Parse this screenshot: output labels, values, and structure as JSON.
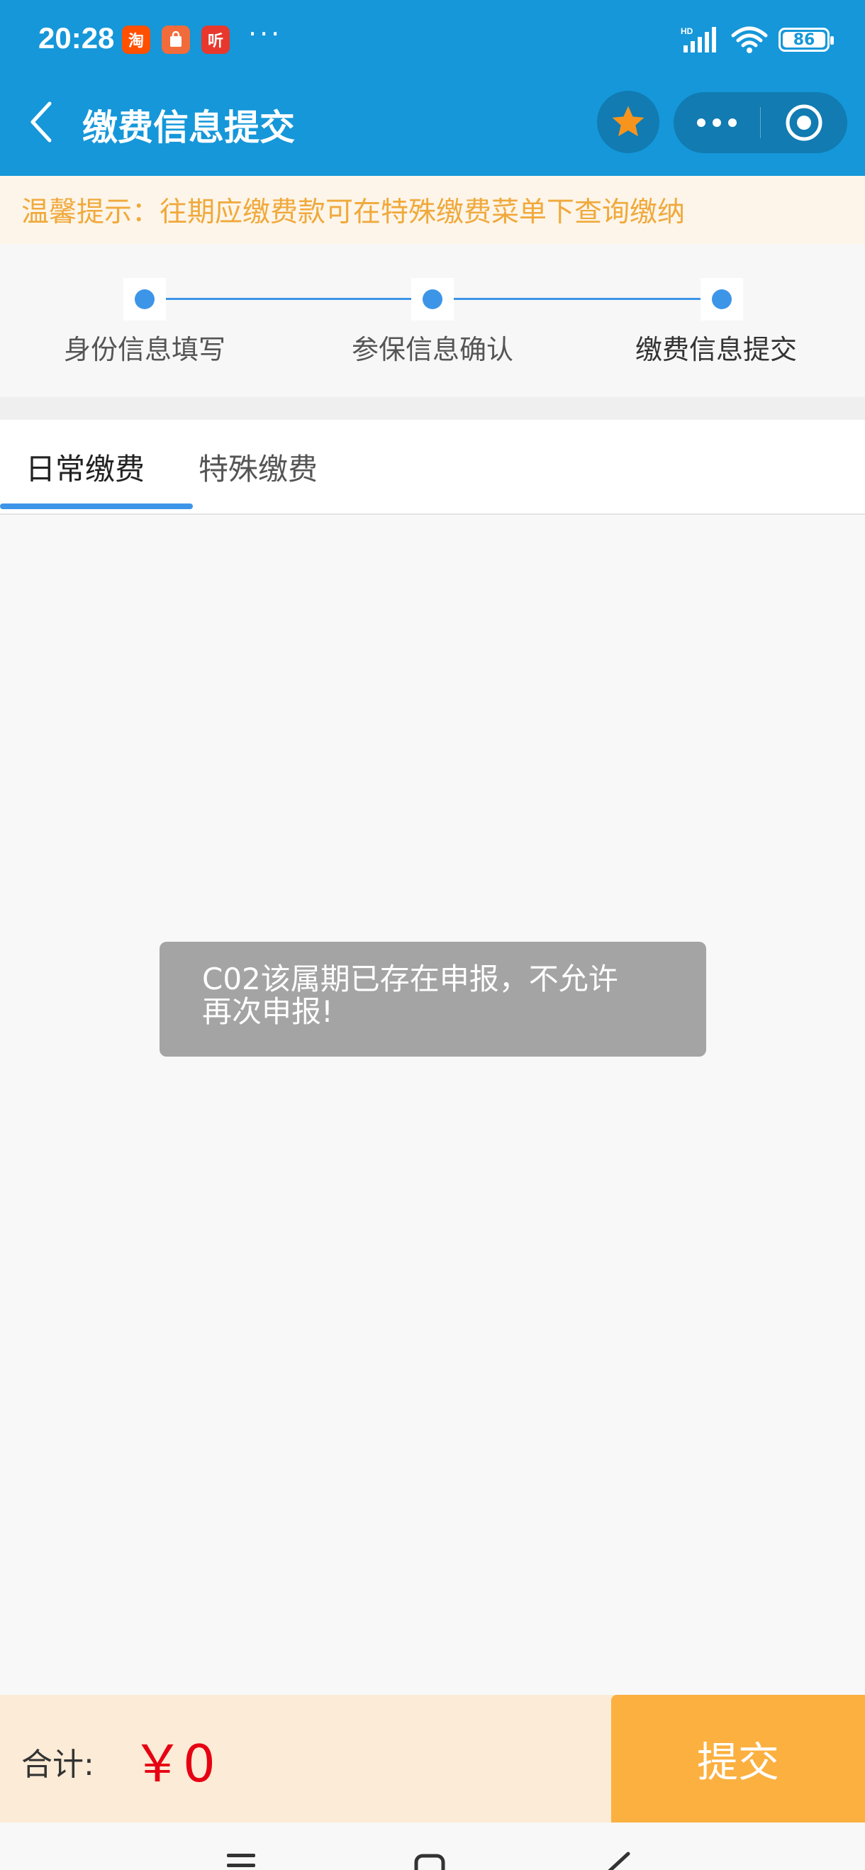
{
  "status_bar": {
    "time": "20:28",
    "app_icons": [
      {
        "name": "taobao-icon",
        "glyph": "淘",
        "color": "#ff5000"
      },
      {
        "name": "shopping-bag-icon",
        "glyph": "",
        "color": "#f26b3a"
      },
      {
        "name": "listen-app-icon",
        "glyph": "听",
        "color": "#e8382d"
      }
    ],
    "more": "···",
    "battery": "86"
  },
  "navbar": {
    "title": "缴费信息提交"
  },
  "notice": {
    "text": "温馨提示：往期应缴费款可在特殊缴费菜单下查询缴纳"
  },
  "steps": [
    {
      "label": "身份信息填写"
    },
    {
      "label": "参保信息确认"
    },
    {
      "label": "缴费信息提交"
    }
  ],
  "tabs": [
    {
      "label": "日常缴费",
      "active": true
    },
    {
      "label": "特殊缴费",
      "active": false
    }
  ],
  "toast": {
    "line1": "C02该属期已存在申报，不允许",
    "line2": "再次申报!"
  },
  "footer": {
    "total_label": "合计:",
    "total_value": "￥0",
    "submit_label": "提交"
  },
  "colors": {
    "primary": "#1597d9",
    "step_blue": "#3d95e8",
    "notice_text": "#f0a93c",
    "submit_button": "#fbb040",
    "total_red": "#e60012"
  }
}
